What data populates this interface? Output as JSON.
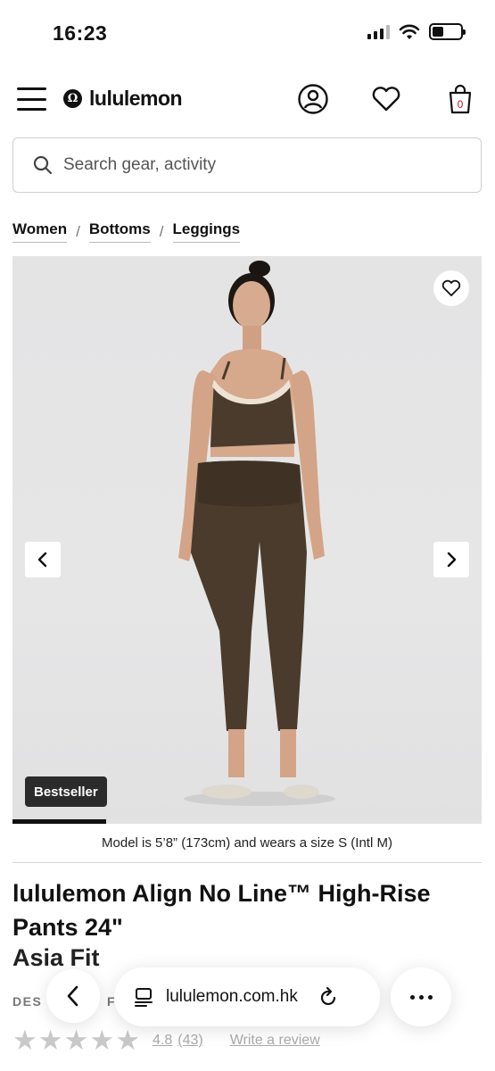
{
  "status_bar": {
    "time": "16:23"
  },
  "header": {
    "brand": "lululemon",
    "brand_mark": "Ω",
    "icons": [
      "menu-icon",
      "account-icon",
      "wishlist-icon",
      "bag-icon"
    ],
    "bag_count": "0"
  },
  "search": {
    "placeholder": "Search gear, activity"
  },
  "breadcrumb": {
    "items": [
      "Women",
      "Bottoms",
      "Leggings"
    ],
    "separator": "/"
  },
  "gallery": {
    "badge": "Bestseller",
    "progress_fraction": 0.2
  },
  "model_info": "Model is 5’8” (173cm) and wears a size S (Intl M)",
  "product": {
    "title": "lululemon Align No Line™ High-Rise Pants 24\"",
    "subtitle": "Asia Fit",
    "desc_label": "DES",
    "desc_label_2": "F",
    "rating_value": "4.8",
    "rating_count": "(43)",
    "write_review": "Write a review"
  },
  "browser": {
    "url": "lululemon.com.hk"
  },
  "colors": {
    "accent": "#111111",
    "product_color": "#4a3b2c",
    "badge_bg": "#2b2b2b"
  }
}
